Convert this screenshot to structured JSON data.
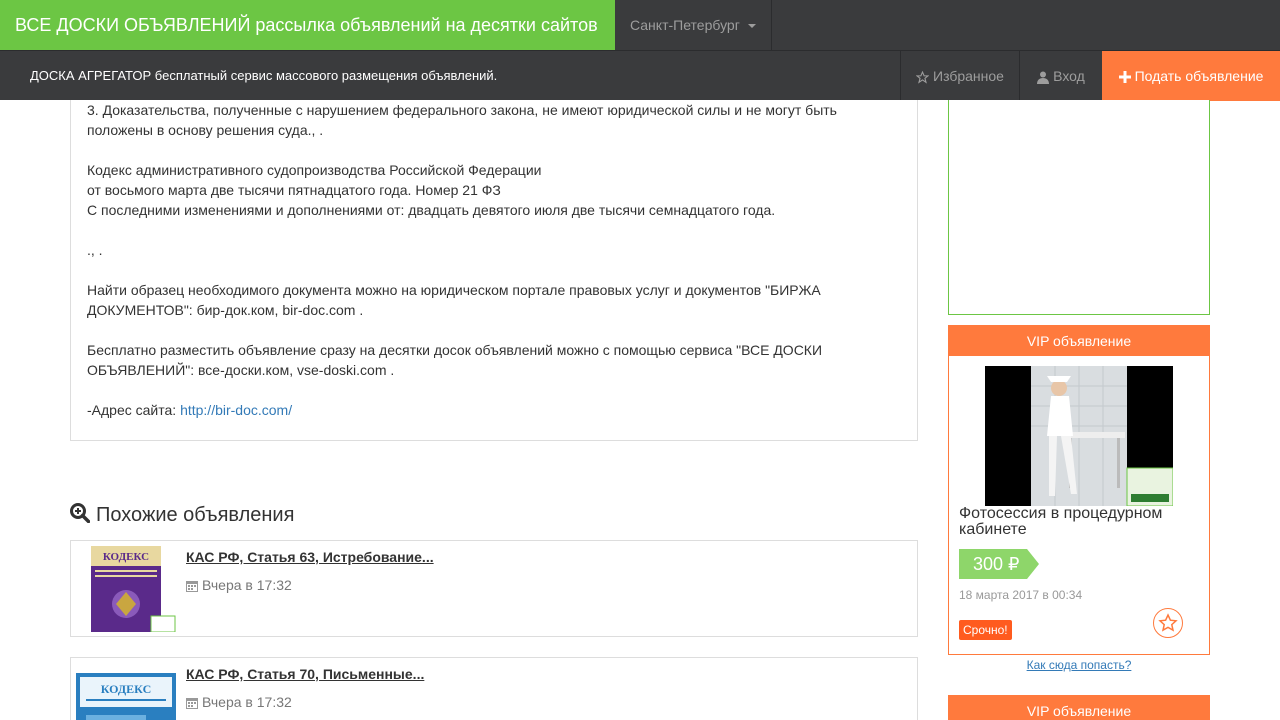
{
  "header": {
    "brand": "ВСЕ ДОСКИ ОБЪЯВЛЕНИЙ рассылка объявлений на десятки сайтов",
    "city": "Санкт-Петербург",
    "tagline": "ДОСКА АГРЕГАТОР бесплатный сервис массового размещения объявлений.",
    "favorites": "Избранное",
    "login": "Вход",
    "post_ad": "Подать объявление"
  },
  "article": {
    "p1_line1": "3. Доказательства, полученные с нарушением федерального закона, не имеют юридической силы и не могут быть",
    "p1_line2": "положены в основу решения суда., .",
    "p2_line1": "Кодекс административного судопроизводства Российской Федерации",
    "p2_line2": "от восьмого марта две тысячи пятнадцатого года. Номер 21 ФЗ",
    "p2_line3": "С последними изменениями и дополнениями от: двадцать девятого июля две тысячи семнадцатого года.",
    "p3": "., .",
    "p4_line1": "Найти образец необходимого документа можно на юридическом портале правовых услуг и документов \"БИРЖА",
    "p4_line2": "ДОКУМЕНТОВ\": бир-док.ком, bir-doc.com .",
    "p5_line1": "Бесплатно разместить объявление сразу на десятки досок объявлений можно с помощью сервиса \"ВСЕ ДОСКИ",
    "p5_line2": "ОБЪЯВЛЕНИЙ\": все-доски.ком, vse-doski.com .",
    "site_label": "-Адрес сайта: ",
    "site_link": "http://bir-doc.com/"
  },
  "similar": {
    "title": "Похожие объявления",
    "items": [
      {
        "title": "КАС РФ, Статья 63, Истребование...",
        "date": "Вчера в 17:32",
        "thumb_text": "КОДЕКС"
      },
      {
        "title": "КАС РФ, Статья 70, Письменные...",
        "date": "Вчера в 17:32",
        "thumb_text": "КОДЕКС"
      }
    ]
  },
  "sidebar": {
    "vip_label": "VIP объявление",
    "vip_title": "Фотосессия в процедурном кабинете",
    "vip_price": "300 ₽",
    "vip_date": "18 марта 2017 в 00:34",
    "vip_urgent": "Срочно!",
    "howto": "Как сюда попасть?",
    "vip2_label": "VIP объявление"
  },
  "colors": {
    "green": "#6cc644",
    "orange": "#ff7a3d",
    "dark": "#3a3b3d",
    "link": "#337ab7"
  }
}
